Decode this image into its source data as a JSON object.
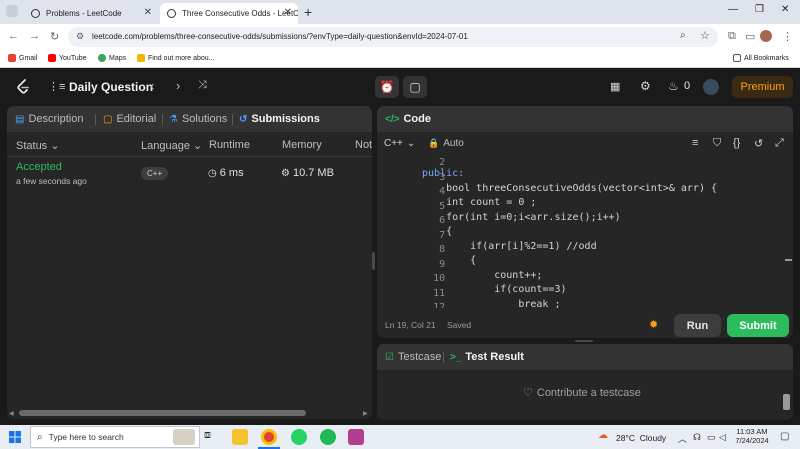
{
  "browser": {
    "tabs": [
      {
        "title": "Problems - LeetCode"
      },
      {
        "title": "Three Consecutive Odds - LeetC"
      }
    ],
    "url": "leetcode.com/problems/three-consecutive-odds/submissions/?envType=daily-question&envId=2024-07-01",
    "bookmarks": [
      "Gmail",
      "YouTube",
      "Maps",
      "Find out more abou..."
    ],
    "all_bookmarks": "All Bookmarks"
  },
  "header": {
    "title": "Daily Question",
    "streak": "0",
    "premium": "Premium"
  },
  "left": {
    "tabs": [
      "Description",
      "Editorial",
      "Solutions",
      "Submissions"
    ],
    "columns": [
      "Status",
      "Language",
      "Runtime",
      "Memory",
      "Not"
    ],
    "submission": {
      "status": "Accepted",
      "time": "a few seconds ago",
      "language": "C++",
      "runtime": "6 ms",
      "memory": "10.7 MB"
    }
  },
  "code_panel": {
    "title": "Code",
    "language": "C++",
    "mode": "Auto",
    "lines": [
      {
        "n": "2",
        "text": "public:"
      },
      {
        "n": "3",
        "text": "    bool threeConsecutiveOdds(vector<int>& arr) {"
      },
      {
        "n": "4",
        "text": "    int count = 0 ;"
      },
      {
        "n": "5",
        "text": "    for(int i=0;i<arr.size();i++)"
      },
      {
        "n": "6",
        "text": "    {"
      },
      {
        "n": "7",
        "text": "        if(arr[i]%2==1) //odd"
      },
      {
        "n": "8",
        "text": "        {"
      },
      {
        "n": "9",
        "text": "            count++;"
      },
      {
        "n": "10",
        "text": "            if(count==3)"
      },
      {
        "n": "11",
        "text": "                break ;"
      },
      {
        "n": "12",
        "text": "        }"
      }
    ],
    "cursor": "Ln 19, Col 21",
    "saved": "Saved",
    "run": "Run",
    "submit": "Submit"
  },
  "test_panel": {
    "tabs": [
      "Testcase",
      "Test Result"
    ],
    "contribute": "Contribute a testcase"
  },
  "taskbar": {
    "search_placeholder": "Type here to search",
    "weather": "28°C  Cloudy",
    "time": "11:03 AM",
    "date": "7/24/2024"
  },
  "colors": {
    "accent_green": "#2cbb5d",
    "accepted": "#2cbb5d",
    "premium_text": "#ffa116",
    "active_tab_icon": "#4c9bff"
  }
}
